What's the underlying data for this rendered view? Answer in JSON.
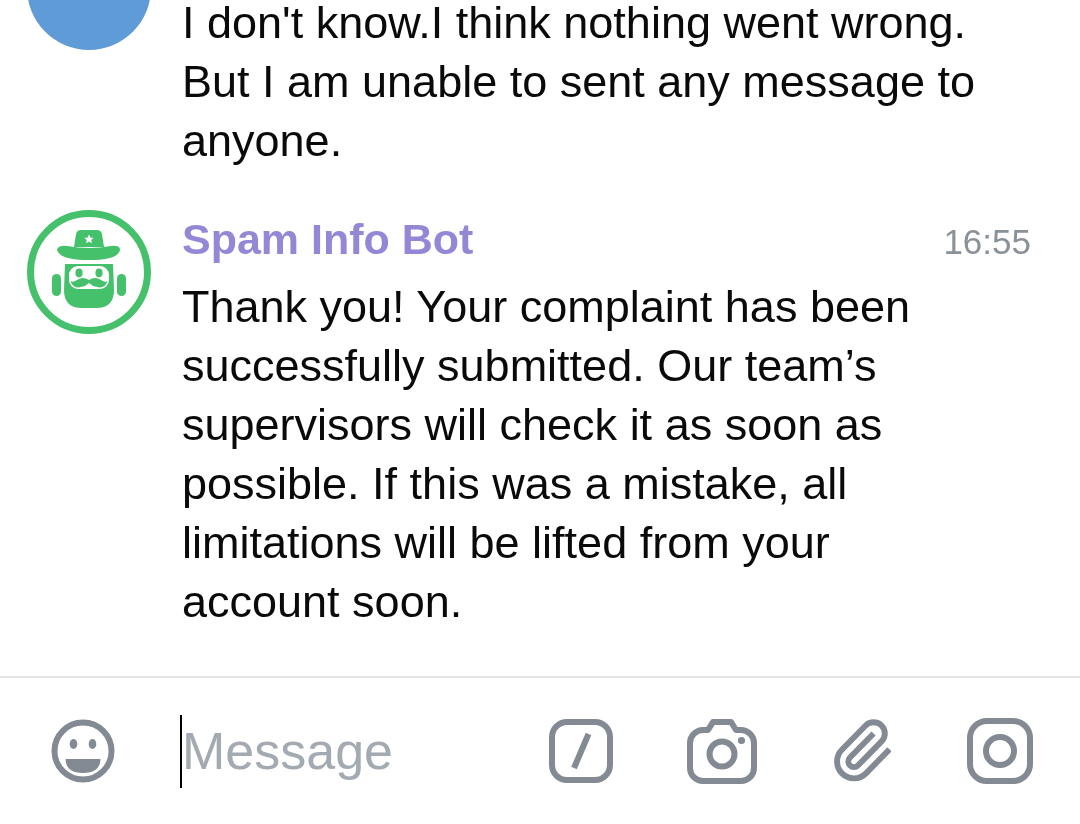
{
  "messages": [
    {
      "avatar": {
        "kind": "plain",
        "color": "#5f9bd7"
      },
      "text": "I don't know.I think nothing went wrong. But I am unable to sent any message to anyone."
    },
    {
      "avatar": {
        "kind": "bot",
        "color": "#45c16b"
      },
      "sender": {
        "name": "Spam Info Bot",
        "color": "#9487d6"
      },
      "time": "16:55",
      "text": "Thank you! Your complaint has been successfully submitted. Our team’s supervisors will check it as soon as possible. If this was a mistake, all limitations will be lifted from your account soon."
    }
  ],
  "composer": {
    "placeholder": "Message",
    "focused": true
  }
}
